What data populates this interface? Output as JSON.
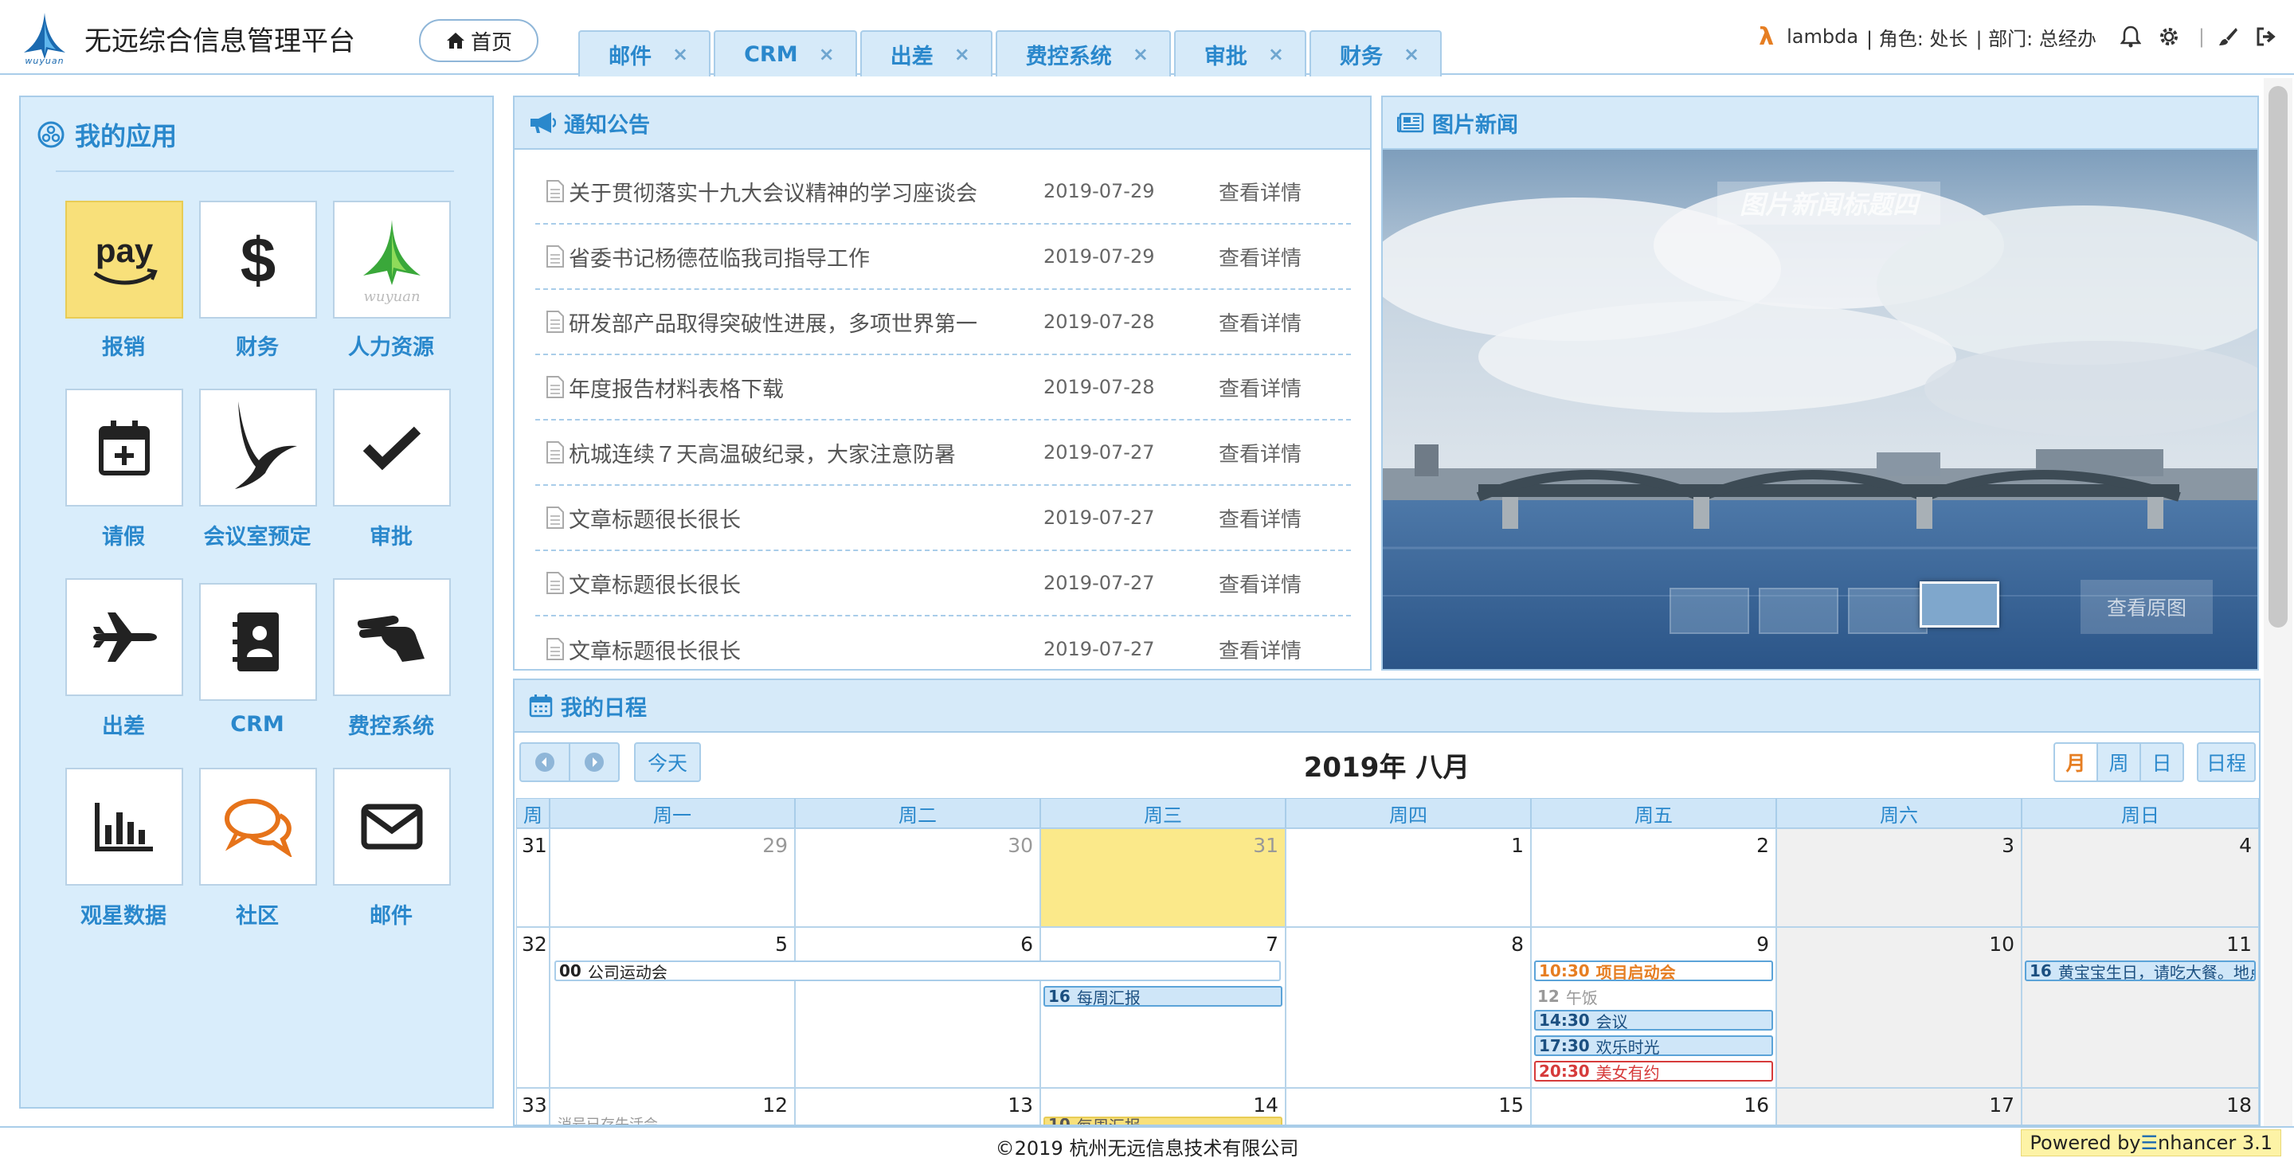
{
  "header": {
    "logo_text": "wuyuan",
    "app_title": "无远综合信息管理平台",
    "home_label": "首页",
    "tabs": [
      {
        "label": "邮件"
      },
      {
        "label": "CRM"
      },
      {
        "label": "出差"
      },
      {
        "label": "费控系统"
      },
      {
        "label": "审批"
      },
      {
        "label": "财务"
      }
    ],
    "tab_close": "×",
    "user": {
      "lambda": "λ",
      "name": "lambda",
      "role": "| 角色: 处长",
      "dept": "| 部门: 总经办"
    },
    "separator": "|"
  },
  "my_apps": {
    "title": "我的应用",
    "items": [
      {
        "label": "报销",
        "icon": "amazon-pay-icon"
      },
      {
        "label": "财务",
        "icon": "dollar-icon"
      },
      {
        "label": "人力资源",
        "icon": "wuyuan-logo-icon"
      },
      {
        "label": "请假",
        "icon": "calendar-plus-icon"
      },
      {
        "label": "会议室预定",
        "icon": "bird-icon"
      },
      {
        "label": "审批",
        "icon": "check-icon"
      },
      {
        "label": "出差",
        "icon": "plane-icon"
      },
      {
        "label": "CRM",
        "icon": "address-book-icon"
      },
      {
        "label": "费控系统",
        "icon": "hand-icon"
      },
      {
        "label": "观星数据",
        "icon": "bar-chart-icon"
      },
      {
        "label": "社区",
        "icon": "comments-icon"
      },
      {
        "label": "邮件",
        "icon": "envelope-icon"
      }
    ],
    "pay_text": "pay"
  },
  "notices": {
    "title": "通知公告",
    "detail_label": "查看详情",
    "items": [
      {
        "title": "关于贯彻落实十九大会议精神的学习座谈会",
        "date": "2019-07-29"
      },
      {
        "title": "省委书记杨德莅临我司指导工作",
        "date": "2019-07-29"
      },
      {
        "title": "研发部产品取得突破性进展，多项世界第一",
        "date": "2019-07-28"
      },
      {
        "title": "年度报告材料表格下载",
        "date": "2019-07-28"
      },
      {
        "title": "杭城连续７天高温破纪录，大家注意防暑",
        "date": "2019-07-27"
      },
      {
        "title": "文章标题很长很长",
        "date": "2019-07-27"
      },
      {
        "title": "文章标题很长很长",
        "date": "2019-07-27"
      },
      {
        "title": "文章标题很长很长",
        "date": "2019-07-27"
      }
    ]
  },
  "news": {
    "title": "图片新闻",
    "caption": "图片新闻标题四",
    "view_original": "查看原图",
    "active_thumb": 4
  },
  "schedule": {
    "title": "我的日程",
    "today_label": "今天",
    "month_title": "2019年 八月",
    "view_buttons": [
      "月",
      "周",
      "日"
    ],
    "active_view": "月",
    "agenda_label": "日程",
    "week_col": "周",
    "weekdays": [
      "周一",
      "周二",
      "周三",
      "周四",
      "周五",
      "周六",
      "周日"
    ],
    "weeks": [
      {
        "num": "31",
        "days": [
          "29",
          "30",
          "31",
          "1",
          "2",
          "3",
          "4"
        ]
      },
      {
        "num": "32",
        "days": [
          "5",
          "6",
          "7",
          "8",
          "9",
          "10",
          "11"
        ]
      },
      {
        "num": "33",
        "days": [
          "12",
          "13",
          "14",
          "15",
          "16",
          "17",
          "18"
        ]
      }
    ],
    "events": {
      "sports": {
        "time": "00",
        "text": "公司运动会"
      },
      "weekly": {
        "time": "16",
        "text": "每周汇报"
      },
      "kickoff": {
        "time": "10:30",
        "text": "项目启动会"
      },
      "lunch": {
        "time": "12",
        "text": "午饭"
      },
      "meeting": {
        "time": "14:30",
        "text": "会议"
      },
      "happy": {
        "time": "17:30",
        "text": "欢乐时光"
      },
      "date": {
        "time": "20:30",
        "text": "美女有约"
      },
      "birthday": {
        "time": "16",
        "text": "黄宝宝生日，请吃大餐。地点"
      },
      "week3a": {
        "time": "",
        "text": "消号已存失活会"
      },
      "week3b": {
        "time": "10",
        "text": "每周汇报"
      }
    }
  },
  "footer": {
    "copyright": "©2019 杭州无远信息技术有限公司",
    "powered_prefix": "Powered by ",
    "powered_brand_mark": "☰",
    "powered_brand": "nhancer 3.1"
  },
  "colors": {
    "accent": "#2a88cc",
    "panel_bg": "#d9edfb",
    "today": "#fbe98a",
    "pay_tile": "#f8e07a",
    "event_orange": "#e67e22",
    "event_red": "#d63b3b"
  }
}
